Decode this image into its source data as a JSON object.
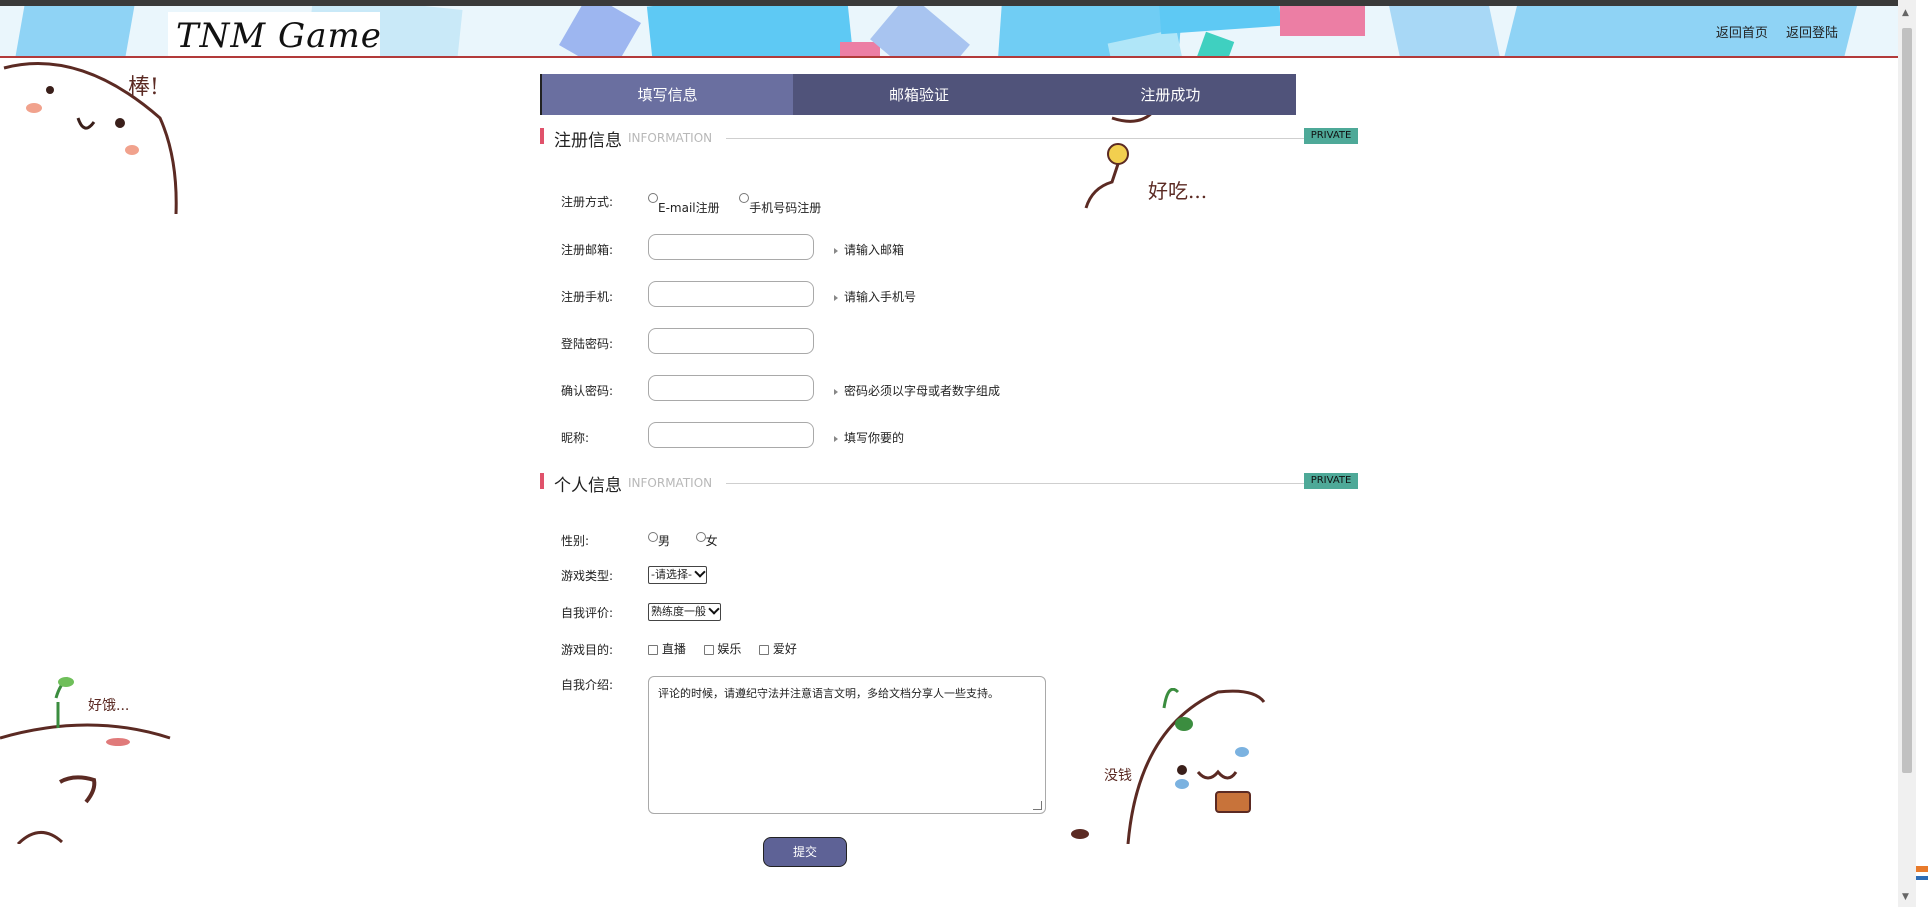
{
  "header": {
    "logo": "TNM Game",
    "nav": [
      "返回首页",
      "返回登陆"
    ]
  },
  "steps": [
    "填写信息",
    "邮箱验证",
    "注册成功"
  ],
  "section_register": {
    "title": "注册信息",
    "sub": "INFORMATION",
    "badge": "PRIVATE"
  },
  "section_personal": {
    "title": "个人信息",
    "sub": "INFORMATION",
    "badge": "PRIVATE"
  },
  "register": {
    "method_label": "注册方式:",
    "method_options": [
      "E-mail注册",
      "手机号码注册"
    ],
    "email_label": "注册邮箱:",
    "email_hint": "请输入邮箱",
    "phone_label": "注册手机:",
    "phone_hint": "请输入手机号",
    "password_label": "登陆密码:",
    "confirm_label": "确认密码:",
    "confirm_hint": "密码必须以字母或者数字组成",
    "nickname_label": "昵称:",
    "nickname_hint": "填写你要的"
  },
  "personal": {
    "gender_label": "性别:",
    "gender_options": [
      "男",
      "女"
    ],
    "game_type_label": "游戏类型:",
    "game_type_value": "-请选择-",
    "self_eval_label": "自我评价:",
    "self_eval_value": "熟练度一般",
    "purpose_label": "游戏目的:",
    "purpose_options": [
      "直播",
      "娱乐",
      "爱好"
    ],
    "intro_label": "自我介绍:",
    "intro_text": "评论的时候，请遵纪守法并注意语言文明，多给文档分享人一些支持。"
  },
  "submit_label": "提交",
  "doodles": {
    "top_left": "棒!",
    "top_right": "好吃...",
    "bottom_left": "好饿...",
    "bottom_right": "没钱"
  },
  "colors": {
    "tab_bg": "#50537a",
    "tab_active": "#6a6fa0",
    "badge": "#4ea998",
    "section_bar": "#e0526b",
    "submit": "#5e6296"
  }
}
